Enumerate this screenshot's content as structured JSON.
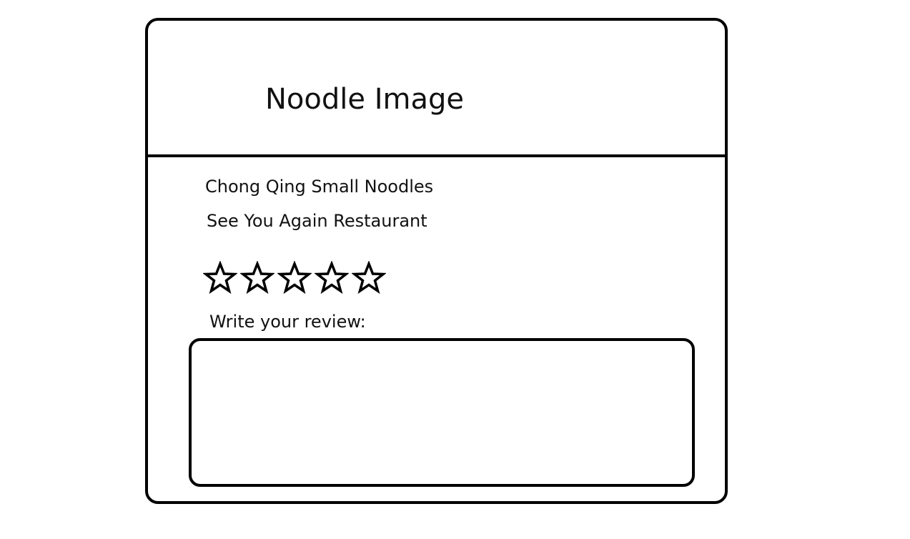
{
  "card": {
    "image_placeholder": "Noodle Image",
    "dish_name": "Chong Qing Small Noodles",
    "restaurant_name": "See You Again Restaurant",
    "rating": {
      "max_stars": 5,
      "selected": 0
    },
    "review": {
      "label": "Write your review:",
      "value": ""
    }
  },
  "colors": {
    "outline": "#000000",
    "background": "#ffffff"
  },
  "icons": {
    "star": "star-outline-icon"
  }
}
